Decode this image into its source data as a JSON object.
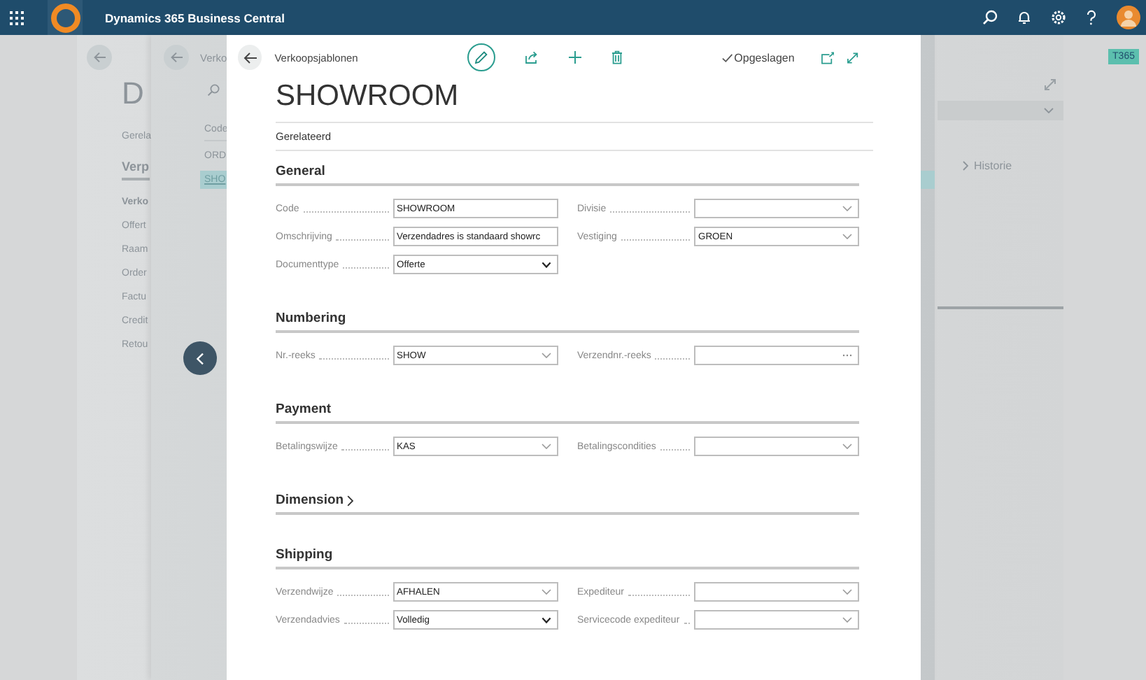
{
  "top_bar": {
    "title": "Dynamics 365 Business Central"
  },
  "environment_badge": "T365",
  "background_page": {
    "title": "D",
    "related": "Gerela",
    "section": "Verp",
    "group": "Verko",
    "items": [
      "Offert",
      "Raam",
      "Order",
      "Factu",
      "Credit",
      "Retou"
    ],
    "side_link": "Historie"
  },
  "background_list": {
    "title": "Verko",
    "column": "Code",
    "rows": [
      {
        "code": "ORD",
        "selected": false
      },
      {
        "code": "SHO",
        "selected": true
      }
    ]
  },
  "dialog": {
    "breadcrumb": "Verkoopsjablonen",
    "status": "Opgeslagen",
    "title": "SHOWROOM",
    "related": "Gerelateerd",
    "sections": [
      {
        "title": "General",
        "expanded": true,
        "fields": [
          {
            "label": "Code",
            "kind": "text",
            "value": "SHOWROOM"
          },
          {
            "label": "Divisie",
            "kind": "lookup"
          },
          {
            "label": "Omschrijving",
            "kind": "text",
            "value": "Verzendadres is standaard showrc"
          },
          {
            "label": "Vestiging",
            "kind": "lookup",
            "value": "GROEN"
          },
          {
            "label": "Documenttype",
            "kind": "select",
            "value": "Offerte"
          }
        ]
      },
      {
        "title": "Numbering",
        "expanded": true,
        "fields": [
          {
            "label": "Nr.-reeks",
            "kind": "lookup",
            "value": "SHOW"
          },
          {
            "label": "Verzendnr.-reeks",
            "kind": "assist"
          }
        ]
      },
      {
        "title": "Payment",
        "expanded": true,
        "fields": [
          {
            "label": "Betalingswijze",
            "kind": "lookup",
            "value": "KAS"
          },
          {
            "label": "Betalingscondities",
            "kind": "lookup"
          }
        ]
      },
      {
        "title": "Dimension",
        "expanded": false
      },
      {
        "title": "Shipping",
        "expanded": true,
        "fields": [
          {
            "label": "Verzendwijze",
            "kind": "lookup",
            "value": "AFHALEN"
          },
          {
            "label": "Expediteur",
            "kind": "lookup"
          },
          {
            "label": "Verzendadvies",
            "kind": "select",
            "value": "Volledig"
          },
          {
            "label": "Servicecode expediteur",
            "kind": "lookup"
          }
        ]
      }
    ]
  }
}
